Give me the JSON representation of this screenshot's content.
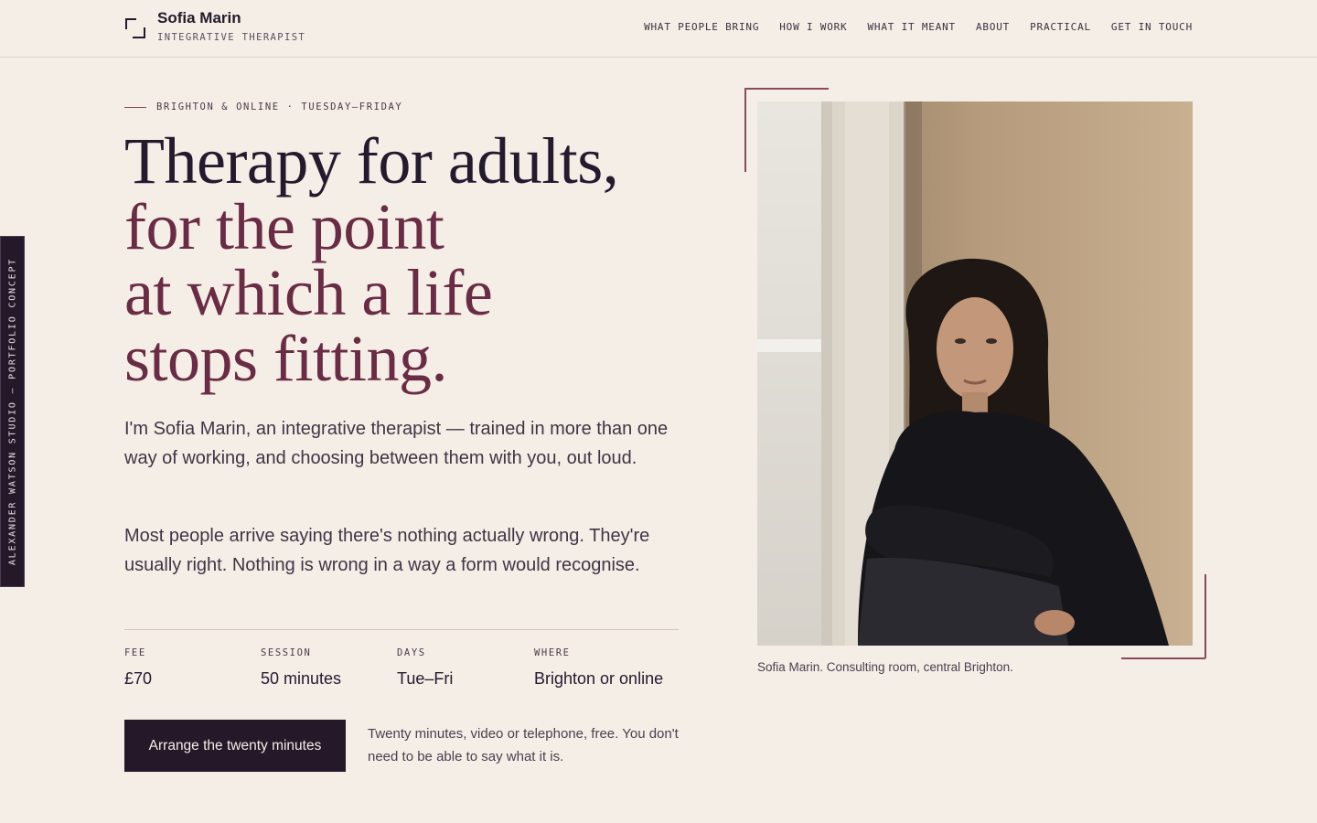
{
  "brand": {
    "name": "Sofia Marin",
    "role": "INTEGRATIVE THERAPIST",
    "mark_icon": "corner-bracket-icon"
  },
  "nav": {
    "items": [
      {
        "label": "WHAT PEOPLE BRING"
      },
      {
        "label": "HOW I WORK"
      },
      {
        "label": "WHAT IT MEANT"
      },
      {
        "label": "ABOUT"
      },
      {
        "label": "PRACTICAL"
      },
      {
        "label": "GET IN TOUCH"
      }
    ]
  },
  "side_tab": {
    "label": "ALEXANDER WATSON STUDIO — PORTFOLIO CONCEPT"
  },
  "hero": {
    "eyebrow": "BRIGHTON & ONLINE · TUESDAY–FRIDAY",
    "headline": {
      "line1": "Therapy for adults,",
      "line2": "for the point",
      "line3": "at which a life",
      "line4": "stops fitting."
    },
    "intro": "I'm Sofia Marin, an integrative therapist — trained in more than one way of working, and choosing between them with you, out loud.",
    "intro2": "Most people arrive saying there's nothing actually wrong. They're usually right. Nothing is wrong in a way a form would recognise.",
    "facts": [
      {
        "label": "FEE",
        "value": "£70"
      },
      {
        "label": "SESSION",
        "value": "50 minutes"
      },
      {
        "label": "DAYS",
        "value": "Tue–Fri"
      },
      {
        "label": "WHERE",
        "value": "Brighton or online"
      }
    ],
    "cta_label": "Arrange the twenty minutes",
    "cta_note": "Twenty minutes, video or telephone, free. You don't need to be able to say what it is."
  },
  "photo": {
    "caption": "Sofia Marin. Consulting room, central Brighton."
  },
  "colors": {
    "background": "#f4eee7",
    "ink": "#241a2e",
    "accent": "#6a2c44",
    "button": "#241829"
  }
}
